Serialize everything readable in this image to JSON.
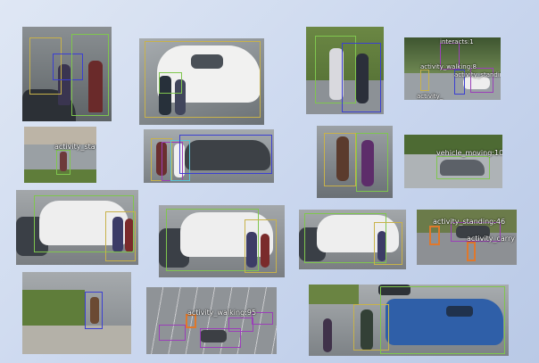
{
  "overlay_labels": {
    "t4_a": "interacts:1",
    "t4_b": "activity_walking:8",
    "t4_c": "activity_standing:27",
    "t4_d": "activity_",
    "t5": "activity_sta",
    "t8": "vehicle_moving:101",
    "t12_a": "activity_standing:46",
    "t12_b": "activity_carry",
    "t14": "activity_walking:95"
  },
  "colors": {
    "background_light": "#dfe7f4",
    "background_dark": "#b9c9e6",
    "box_green": "#7fc64e",
    "box_yellow": "#c8b24a",
    "box_blue": "#3b3fd1",
    "box_purple": "#9b3fb8",
    "box_orange": "#e0782b"
  }
}
